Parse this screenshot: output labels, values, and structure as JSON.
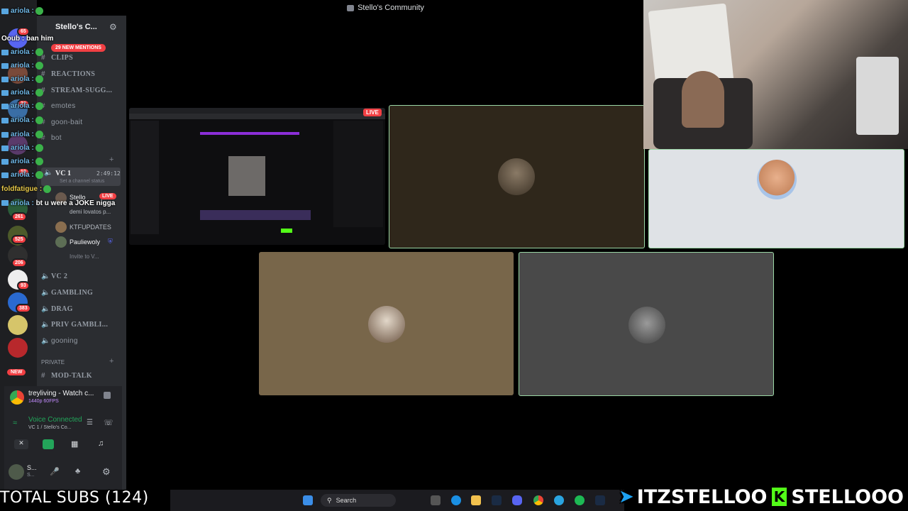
{
  "window": {
    "title": "Stello's Community"
  },
  "server": {
    "name": "Stello's C...",
    "mentions_banner": "29 NEW MENTIONS"
  },
  "rail_badges": [
    "65",
    "22",
    "10",
    "261",
    "525",
    "206",
    "93",
    "383"
  ],
  "rail_new": "NEW",
  "channels": {
    "text": [
      "CLIPS",
      "REACTIONS",
      "STREAM-SUGG...",
      "emotes",
      "goon-bait",
      "bot"
    ],
    "voice_active": {
      "name": "VC 1",
      "timer": "2:49:12",
      "status": "Set a channel status"
    },
    "voice_members": [
      {
        "name": "Stello",
        "badge": "LIVE",
        "sub": "demi lovatos p..."
      },
      {
        "name": "KTFUPDATES"
      },
      {
        "name": "Pauliewoly"
      }
    ],
    "invite": "Invite to V...",
    "voice_other": [
      "VC 2",
      "GAMBLING",
      "DRAG",
      "PRIV GAMBLI...",
      "gooning"
    ],
    "private_header": "PRIVATE",
    "private_channels": [
      "MOD-TALK"
    ]
  },
  "activity": {
    "title": "treyliving - Watch c...",
    "detail": "1440p 60FPS"
  },
  "voice_status": {
    "title": "Voice Connected",
    "channel": "VC 1 / Stello's Co..."
  },
  "user": {
    "name": "S...",
    "status": "S..."
  },
  "chat_overlay": [
    {
      "user": "ariola",
      "msg": ""
    },
    {
      "user": "Ooub",
      "msg": "ban him"
    },
    {
      "user": "ariola",
      "msg": ""
    },
    {
      "user": "ariola",
      "msg": ""
    },
    {
      "user": "ariola",
      "msg": ""
    },
    {
      "user": "ariola",
      "msg": ""
    },
    {
      "user": "ariola",
      "msg": ""
    },
    {
      "user": "ariola",
      "msg": ""
    },
    {
      "user": "ariola",
      "msg": ""
    },
    {
      "user": "ariola",
      "msg": ""
    },
    {
      "user": "ariola",
      "msg": ""
    },
    {
      "user": "ariola",
      "msg": ""
    },
    {
      "user": "ariola",
      "msg": ""
    },
    {
      "user": "foldfatigue",
      "msg": ""
    },
    {
      "user": "ariola",
      "msg": "bt u were a JOKE nigga"
    }
  ],
  "stream_tile": {
    "live_badge": "LIVE"
  },
  "taskbar": {
    "search": "Search"
  },
  "total_subs": "TOTAL SUBS (124)",
  "socials": {
    "twitter": "ITZSTELLOO",
    "kick": "STELLOOO"
  },
  "colors": {
    "accent_green": "#23a55a",
    "live_red": "#f23f43",
    "kick_green": "#53fc18"
  }
}
